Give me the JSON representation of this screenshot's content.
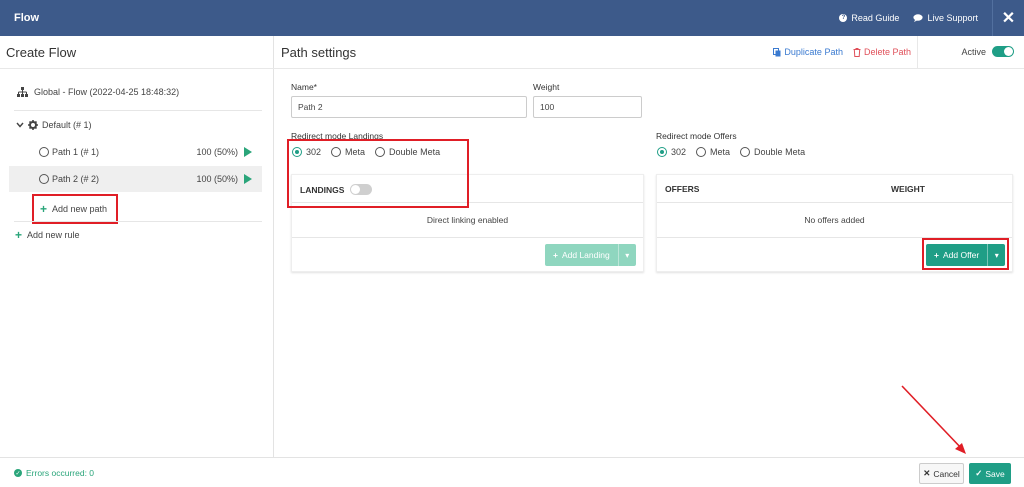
{
  "topbar": {
    "title": "Flow",
    "read_guide": "Read Guide",
    "live_support": "Live Support",
    "close": "✕"
  },
  "left": {
    "title": "Create Flow",
    "global": "Global - Flow (2022-04-25 18:48:32)",
    "default_rule": "Default (# 1)",
    "paths": [
      {
        "label": "Path 1 (# 1)",
        "weight": "100 (50%)"
      },
      {
        "label": "Path 2 (# 2)",
        "weight": "100 (50%)"
      }
    ],
    "add_new_path": "Add new path",
    "add_new_rule": "Add new rule"
  },
  "path_settings": {
    "title": "Path settings",
    "duplicate": "Duplicate Path",
    "delete": "Delete Path",
    "active_label": "Active",
    "name_label": "Name*",
    "name_value": "Path 2",
    "weight_label": "Weight",
    "weight_value": "100",
    "redirect_landings_label": "Redirect mode Landings",
    "redirect_offers_label": "Redirect mode Offers",
    "redirect_options": [
      "302",
      "Meta",
      "Double Meta"
    ],
    "landings_header": "LANDINGS",
    "landings_empty": "Direct linking enabled",
    "add_landing": "Add Landing",
    "offers_header": "OFFERS",
    "weight_header": "WEIGHT",
    "offers_empty": "No offers added",
    "add_offer": "Add Offer"
  },
  "footer": {
    "errors": "Errors occurred: 0",
    "cancel": "Cancel",
    "save": "Save"
  },
  "colors": {
    "topbar": "#3d5a8a",
    "accent_green": "#1f9e86",
    "highlight_red": "#e01e26",
    "link_blue": "#3a7ad0",
    "delete_red": "#e0505a"
  }
}
